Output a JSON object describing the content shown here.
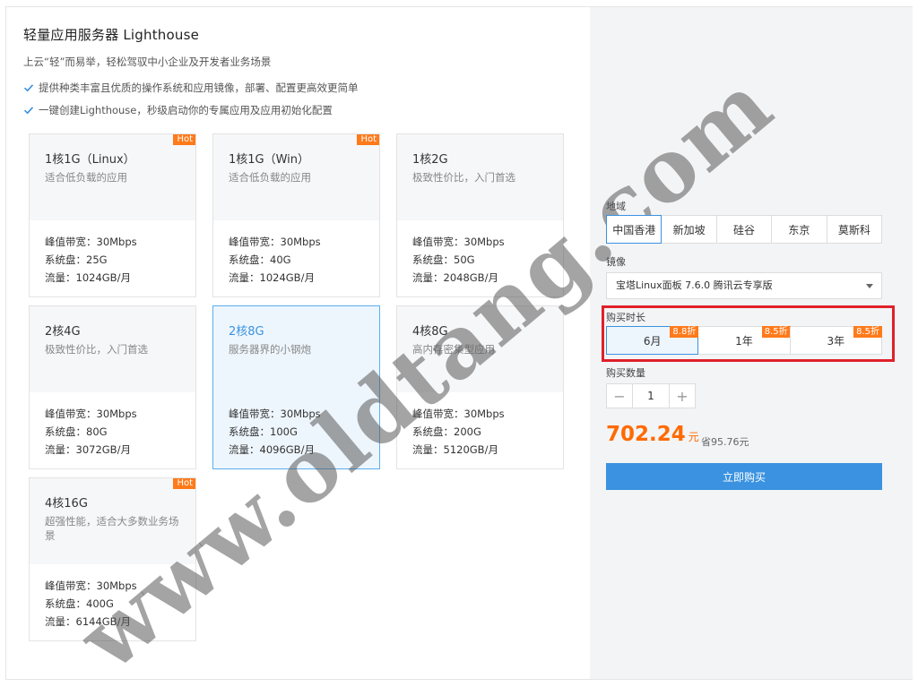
{
  "header": {
    "title": "轻量应用服务器 Lighthouse",
    "subtitle": "上云“轻”而易举，轻松驾驭中小企业及开发者业务场景",
    "features": [
      "提供种类丰富且优质的操作系统和应用镜像，部署、配置更高效更简单",
      "一键创建Lighthouse，秒级启动你的专属应用及应用初始化配置"
    ]
  },
  "plans": [
    {
      "name": "1核1G（Linux）",
      "desc": "适合低负载的应用",
      "badge": "Hot",
      "bandwidth": "峰值带宽：30Mbps",
      "disk": "系统盘：25G",
      "traffic": "流量：1024GB/月"
    },
    {
      "name": "1核1G（Win）",
      "desc": "适合低负载的应用",
      "badge": "Hot",
      "bandwidth": "峰值带宽：30Mbps",
      "disk": "系统盘：40G",
      "traffic": "流量：1024GB/月"
    },
    {
      "name": "1核2G",
      "desc": "极致性价比，入门首选",
      "badge": "",
      "bandwidth": "峰值带宽：30Mbps",
      "disk": "系统盘：50G",
      "traffic": "流量：2048GB/月"
    },
    {
      "name": "2核4G",
      "desc": "极致性价比，入门首选",
      "badge": "",
      "bandwidth": "峰值带宽：30Mbps",
      "disk": "系统盘：80G",
      "traffic": "流量：3072GB/月"
    },
    {
      "name": "2核8G",
      "desc": "服务器界的小钢炮",
      "badge": "",
      "bandwidth": "峰值带宽：30Mbps",
      "disk": "系统盘：100G",
      "traffic": "流量：4096GB/月"
    },
    {
      "name": "4核8G",
      "desc": "高内存密集型应用",
      "badge": "",
      "bandwidth": "峰值带宽：30Mbps",
      "disk": "系统盘：200G",
      "traffic": "流量：5120GB/月"
    },
    {
      "name": "4核16G",
      "desc": "超强性能，适合大多数业务场景",
      "badge": "Hot",
      "bandwidth": "峰值带宽：30Mbps",
      "disk": "系统盘：400G",
      "traffic": "流量：6144GB/月"
    }
  ],
  "selected_plan_index": 4,
  "order": {
    "region_label": "地域",
    "regions": [
      "中国香港",
      "新加坡",
      "硅谷",
      "东京",
      "莫斯科"
    ],
    "selected_region": "中国香港",
    "image_label": "镜像",
    "image_value": "宝塔Linux面板 7.6.0 腾讯云专享版",
    "duration_label": "购买时长",
    "durations": [
      {
        "label": "6月",
        "discount": "8.8折"
      },
      {
        "label": "1年",
        "discount": "8.5折"
      },
      {
        "label": "3年",
        "discount": "8.5折"
      }
    ],
    "selected_duration": "6月",
    "quantity_label": "购买数量",
    "quantity": "1",
    "minus": "−",
    "plus": "+",
    "price": "702.24",
    "price_unit": "元",
    "saving": "省95.76元",
    "buy_label": "立即购买"
  },
  "watermark": "www.oldtang.com",
  "colors": {
    "accent": "#3a92e0",
    "price": "#ff6a00",
    "badge": "#ff7a1a",
    "highlight": "#e0202a"
  }
}
